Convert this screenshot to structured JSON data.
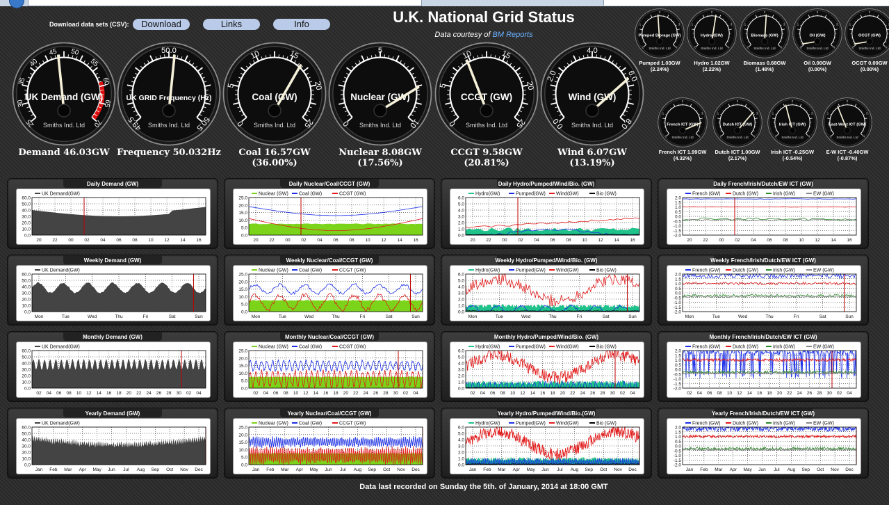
{
  "header": {
    "download_label": "Download data sets (CSV):",
    "buttons": [
      "Download",
      "Links",
      "Info"
    ],
    "title": "U.K. National Grid Status",
    "courtesy_prefix": "Data courtesy of",
    "courtesy_link": "BM Reports"
  },
  "colors": {
    "nuclear": "#7bd41a",
    "coal": "#1a2ee6",
    "ccgt": "#e31a1a",
    "hydro": "#1fc28a",
    "pumped": "#1a2ee6",
    "wind": "#e31a1a",
    "bio": "#000000",
    "french": "#1a2ee6",
    "dutch": "#e31a1a",
    "irish": "#2a8a2a",
    "ew": "#888888",
    "demand": "#444444",
    "now_line": "#c00000"
  },
  "big_gauges": [
    {
      "label": "UK Demand (GW)",
      "brand": "Smiths Ind. Ltd",
      "ticks": [
        "25",
        "30",
        "35",
        "40",
        "45",
        "50",
        "55",
        "60",
        "65",
        "70"
      ],
      "min": 25,
      "max": 70,
      "value": 46.03,
      "redzone": true,
      "caption": [
        "Demand 46.03GW"
      ]
    },
    {
      "label": "UK GRID Frequency (Hz)",
      "brand": "Smiths Ind. Ltd",
      "ticks": [
        "49.5",
        "50.0",
        "50.5"
      ],
      "min": 49.5,
      "max": 50.5,
      "value": 50.032,
      "caption": [
        "Frequency 50.032Hz"
      ]
    },
    {
      "label": "Coal (GW)",
      "brand": "Smiths Ind. Ltd",
      "ticks": [
        "0",
        "5",
        "10",
        "15",
        "20",
        "25"
      ],
      "min": 0,
      "max": 25,
      "value": 16.57,
      "caption": [
        "Coal 16.57GW",
        "(36.00%)"
      ]
    },
    {
      "label": "Nuclear (GW)",
      "brand": "Smiths Ind. Ltd",
      "ticks": [
        "0",
        "5",
        "10"
      ],
      "min": 0,
      "max": 10,
      "value": 8.08,
      "caption": [
        "Nuclear 8.08GW",
        "(17.56%)"
      ]
    },
    {
      "label": "CCGT (GW)",
      "brand": "Smiths Ind. Ltd",
      "ticks": [
        "0",
        "5",
        "10",
        "15",
        "20",
        "25"
      ],
      "min": 0,
      "max": 25,
      "value": 9.58,
      "caption": [
        "CCGT 9.58GW",
        "(20.81%)"
      ]
    },
    {
      "label": "Wind (GW)",
      "brand": "Smiths Ind. Ltd",
      "ticks": [
        "0.0",
        "2.0",
        "4.0",
        "6.0",
        "8.0"
      ],
      "min": 0,
      "max": 8,
      "value": 6.07,
      "caption": [
        "Wind 6.07GW",
        "(13.19%)"
      ]
    }
  ],
  "small_gauges_top": [
    {
      "label": "Pumped Storage (GW)",
      "brand": "Smiths Ind. Ltd",
      "value_frac": 0.48,
      "caption": [
        "Pumped 1.03GW",
        "(2.24%)"
      ]
    },
    {
      "label": "Hydro (GW)",
      "brand": "Smiths Ind. Ltd",
      "value_frac": 0.55,
      "caption": [
        "Hydro 1.02GW",
        "(2.22%)"
      ]
    },
    {
      "label": "Biomass (GW)",
      "brand": "Smiths Ind. Ltd",
      "value_frac": 0.52,
      "caption": [
        "Biomass 0.68GW",
        "(1.48%)"
      ]
    },
    {
      "label": "Oil (GW)",
      "brand": "Smiths Ind. Ltd",
      "value_frac": 0.02,
      "caption": [
        "Oil 0.00GW",
        "(0.00%)"
      ]
    },
    {
      "label": "OCGT (GW)",
      "brand": "Smiths Ind. Ltd",
      "value_frac": 0.02,
      "caption": [
        "OCGT 0.00GW",
        "(0.00%)"
      ]
    }
  ],
  "small_gauges_bottom": [
    {
      "label": "French ICT (GW)",
      "brand": "Smiths Ind. Ltd",
      "value_frac": 0.85,
      "caption": [
        "French ICT 1.99GW",
        "(4.32%)"
      ]
    },
    {
      "label": "Dutch ICT (GW)",
      "brand": "Smiths Ind. Ltd",
      "value_frac": 0.72,
      "caption": [
        "Dutch ICT 1.00GW",
        "(2.17%)"
      ]
    },
    {
      "label": "Irish ICT (GW)",
      "brand": "Smiths Ind. Ltd",
      "value_frac": 0.42,
      "caption": [
        "Irish ICT -0.25GW",
        "(-0.54%)"
      ]
    },
    {
      "label": "East-West ICT (GW)",
      "brand": "Smiths Ind. Ltd",
      "value_frac": 0.38,
      "caption": [
        "E-W ICT -0.40GW",
        "(-0.87%)"
      ]
    }
  ],
  "xlabels": {
    "daily": [
      "20",
      "22",
      "00",
      "02",
      "04",
      "06",
      "08",
      "10",
      "12",
      "14",
      "16"
    ],
    "weekly": [
      "Mon",
      "Tue",
      "Wed",
      "Thu",
      "Fri",
      "Sat",
      "Sun"
    ],
    "monthly": [
      "02",
      "04",
      "06",
      "08",
      "10",
      "12",
      "14",
      "16",
      "18",
      "20",
      "22",
      "24",
      "26",
      "28",
      "30",
      "02",
      "04"
    ],
    "yearly": [
      "Jan",
      "Feb",
      "Mar",
      "Apr",
      "May",
      "Jun",
      "Jul",
      "Aug",
      "Sep",
      "Oct",
      "Nov",
      "Dec"
    ]
  },
  "y_ticks": {
    "demand": [
      "60.0",
      "50.0",
      "40.0",
      "30.0",
      "20.0",
      "10.0",
      "0.0"
    ],
    "ncc": [
      "25.0",
      "20.0",
      "15.0",
      "10.0",
      "5.0",
      "0.0"
    ],
    "hpwb": [
      "6.0",
      "5.0",
      "4.0",
      "3.0",
      "2.0",
      "1.0",
      "0.0"
    ],
    "ict": [
      "2.0",
      "1.5",
      "1.0",
      "0.5",
      "0.0",
      "-0.5",
      "-1.0",
      "-1.5",
      "-2.0"
    ]
  },
  "legends": {
    "demand": [
      "UK Demand(GW)"
    ],
    "ncc": [
      "Nuclear (GW)",
      "Coal (GW)",
      "CCGT (GW)"
    ],
    "hpwb": [
      "Hydro(GW)",
      "Pumped(GW)",
      "Wind(GW)",
      "Bio (GW)"
    ],
    "ict": [
      "French (GW)",
      "Dutch (GW)",
      "Irish (GW)",
      "EW (GW)"
    ]
  },
  "panels": [
    {
      "title": "Daily Demand (GW)",
      "kind": "demand",
      "period": "daily"
    },
    {
      "title": "Daily Nuclear/Coal/CCGT (GW)",
      "kind": "ncc",
      "period": "daily"
    },
    {
      "title": "Daily Hydro/Pumped/Wind/Bio. (GW)",
      "kind": "hpwb",
      "period": "daily"
    },
    {
      "title": "Daily French/Irish/Dutch/EW ICT (GW)",
      "kind": "ict",
      "period": "daily"
    },
    {
      "title": "Weekly Demand (GW)",
      "kind": "demand",
      "period": "weekly"
    },
    {
      "title": "Weekly Nuclear/Coal/CCGT (GW)",
      "kind": "ncc",
      "period": "weekly"
    },
    {
      "title": "Weekly Hydro/Pumped/Wind/Bio. (GW)",
      "kind": "hpwb",
      "period": "weekly"
    },
    {
      "title": "Weekly French/Irish/Dutch/EW ICT (GW)",
      "kind": "ict",
      "period": "weekly"
    },
    {
      "title": "Monthly Demand (GW)",
      "kind": "demand",
      "period": "monthly"
    },
    {
      "title": "Monthly Nuclear/Coal/CCGT (GW)",
      "kind": "ncc",
      "period": "monthly"
    },
    {
      "title": "Monthly Hydro/Pumped/Wind/Bio. (GW)",
      "kind": "hpwb",
      "period": "monthly"
    },
    {
      "title": "Monthly French/Irish/Dutch/EW ICT (GW)",
      "kind": "ict",
      "period": "monthly"
    },
    {
      "title": "Yearly Demand (GW)",
      "kind": "demand",
      "period": "yearly"
    },
    {
      "title": "Yearly Nuclear/Coal/CCGT (GW)",
      "kind": "ncc",
      "period": "yearly"
    },
    {
      "title": "Yearly Hydro/Pumped/Wind/Bio.(GW)",
      "kind": "hpwb",
      "period": "yearly"
    },
    {
      "title": "Yearly French/Irish/Dutch/EW ICT (GW)",
      "kind": "ict",
      "period": "yearly"
    }
  ],
  "footer": "Data last recorded on Sunday the 5th. of January, 2014 at 18:00 GMT"
}
